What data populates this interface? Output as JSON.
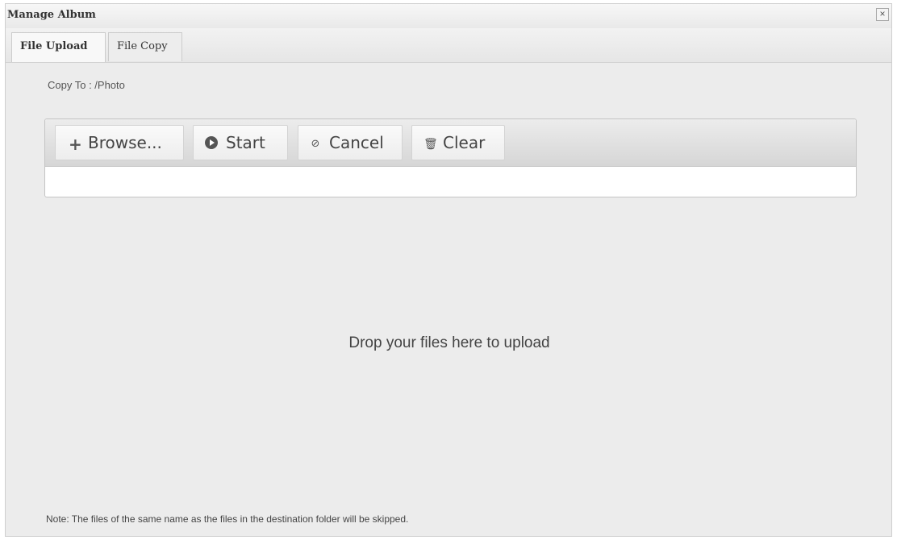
{
  "window": {
    "title": "Manage Album",
    "close_label": "×"
  },
  "tabs": [
    {
      "label": "File Upload",
      "active": true
    },
    {
      "label": "File Copy",
      "active": false
    }
  ],
  "destination": {
    "label": "Copy To : /Photo"
  },
  "toolbar": {
    "browse_icon": "+",
    "browse_label": "Browse...",
    "start_label": "Start",
    "cancel_icon": "⊘",
    "cancel_label": "Cancel",
    "clear_icon": "🗑",
    "clear_label": "Clear"
  },
  "icons": {
    "browse": "plus-icon",
    "start": "play-circle-icon",
    "cancel": "ban-icon",
    "clear": "trash-icon"
  },
  "dropzone": {
    "text": "Drop your files here to upload"
  },
  "note": {
    "text": "Note: The files of the same name as the files in the destination folder will be skipped."
  },
  "colors": {
    "dialog_background": "#ececec",
    "toolbar_background": "#dcdcdc",
    "text": "#444444"
  }
}
